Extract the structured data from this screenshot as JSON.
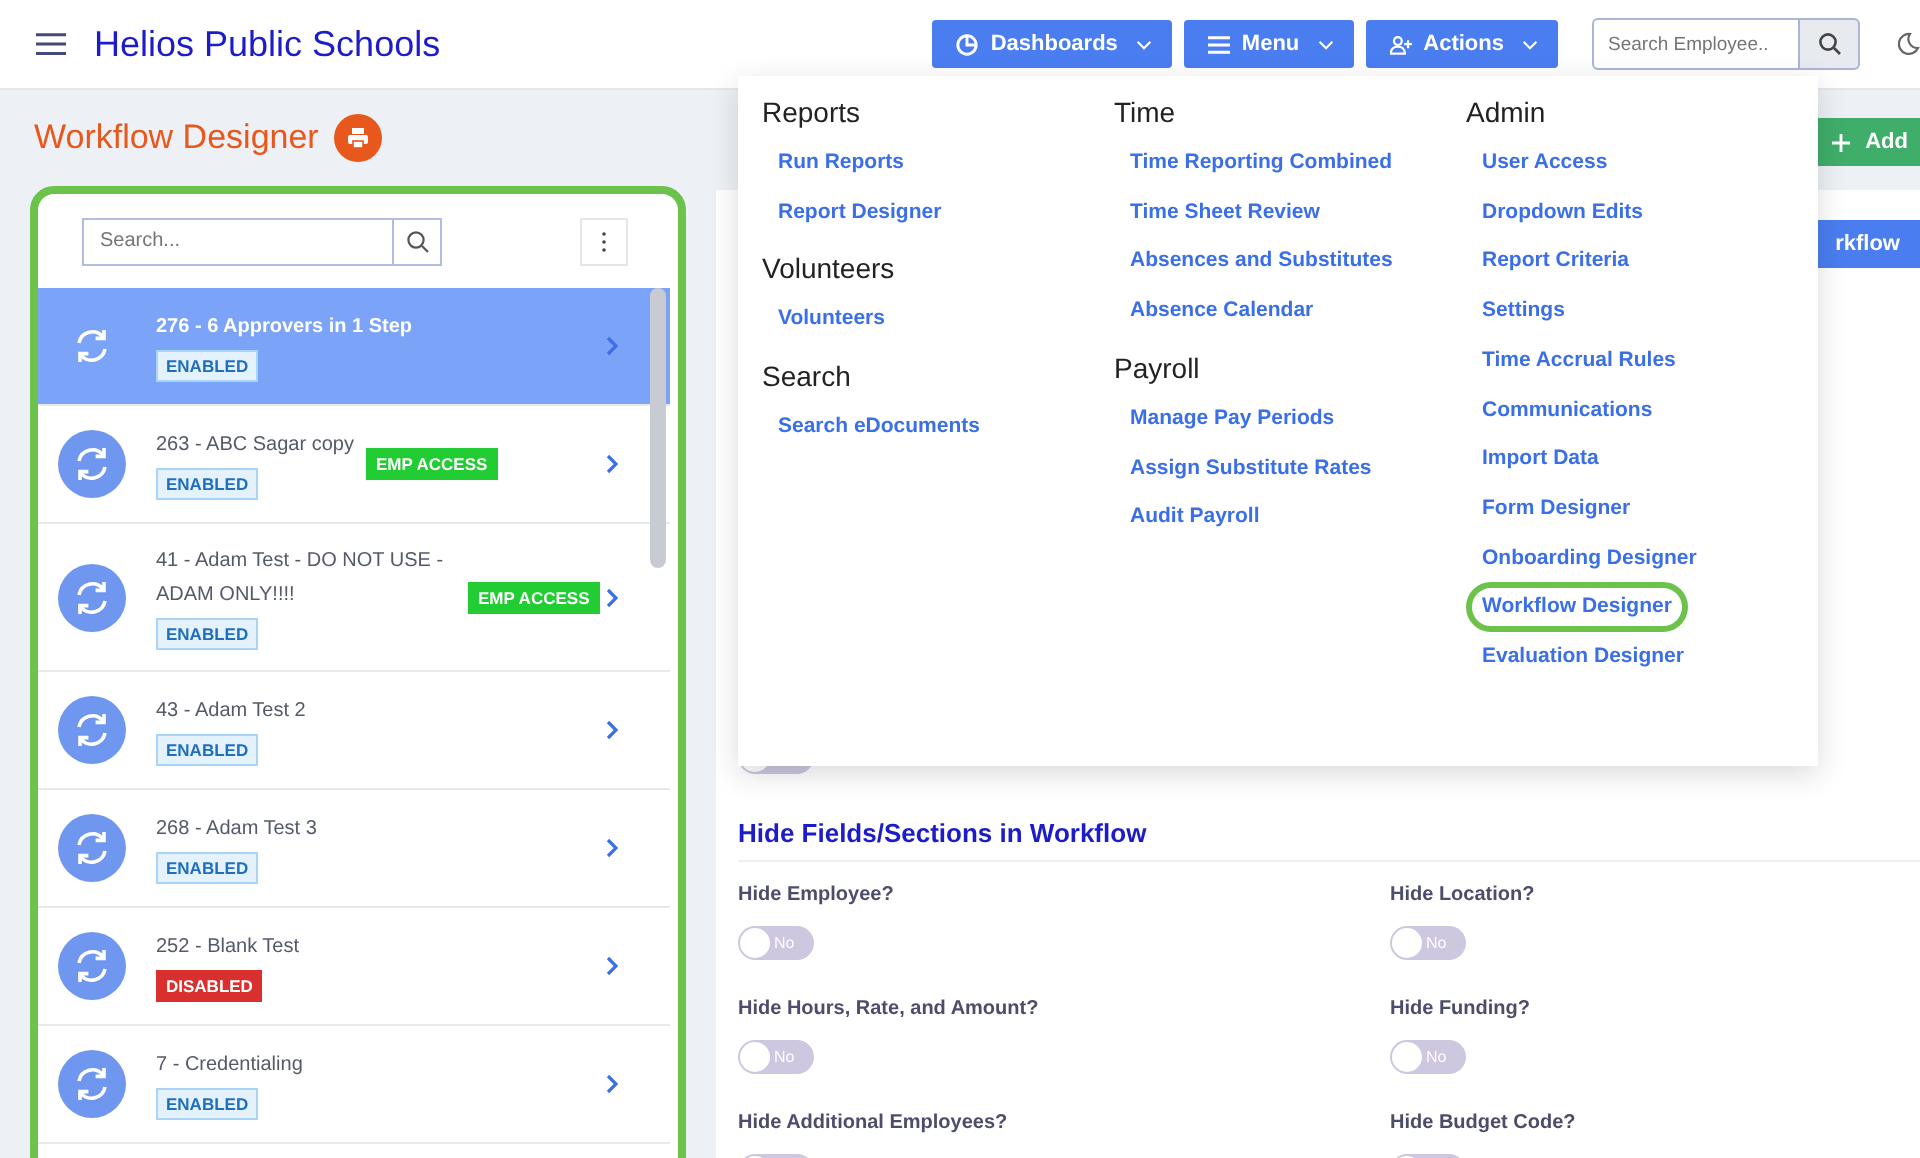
{
  "header": {
    "title": "Helios Public Schools",
    "buttons": [
      {
        "label": "Dashboards",
        "kind": "dashboards"
      },
      {
        "label": "Menu",
        "kind": "menu"
      },
      {
        "label": "Actions",
        "kind": "actions"
      }
    ],
    "search": {
      "placeholder": "Search Employee.."
    }
  },
  "page": {
    "title": "Workflow Designer"
  },
  "list": {
    "search": {
      "placeholder": "Search..."
    },
    "rows": [
      {
        "name": "276 - 6 Approvers in 1 Step",
        "status": {
          "text": "ENABLED",
          "kind": "enabled"
        },
        "selected": true
      },
      {
        "name": "263 - ABC Sagar copy",
        "status": {
          "text": "ENABLED",
          "kind": "enabled"
        },
        "tag": "EMP ACCESS",
        "selected": false
      },
      {
        "name": "41 - Adam Test - DO NOT USE - ADAM ONLY!!!!",
        "status": {
          "text": "ENABLED",
          "kind": "enabled"
        },
        "tag": "EMP ACCESS",
        "selected": false
      },
      {
        "name": "43 - Adam Test 2",
        "status": {
          "text": "ENABLED",
          "kind": "enabled"
        },
        "selected": false
      },
      {
        "name": "268 - Adam Test 3",
        "status": {
          "text": "ENABLED",
          "kind": "enabled"
        },
        "selected": false
      },
      {
        "name": "252 - Blank Test",
        "status": {
          "text": "DISABLED",
          "kind": "disabled"
        },
        "selected": false
      },
      {
        "name": "7 - Credentialing",
        "status": {
          "text": "ENABLED",
          "kind": "enabled"
        },
        "selected": false
      }
    ]
  },
  "content": {
    "add_button": "Add",
    "workflow_button": "rkflow",
    "partial_toggle": {
      "on": false
    },
    "section_title": "Hide Fields/Sections in Workflow",
    "fields": [
      {
        "label": "Hide Employee?",
        "on": false,
        "text": "No"
      },
      {
        "label": "Hide Location?",
        "on": false,
        "text": "No"
      },
      {
        "label": "Hide Hours, Rate, and Amount?",
        "on": false,
        "text": "No"
      },
      {
        "label": "Hide Funding?",
        "on": false,
        "text": "No"
      },
      {
        "label": "Hide Additional Employees?",
        "on": false
      },
      {
        "label": "Hide Budget Code?",
        "on": false
      }
    ]
  },
  "menu": {
    "columns": [
      {
        "sections": [
          {
            "heading": "Reports",
            "items": [
              {
                "label": "Run Reports",
                "highlighted": false
              },
              {
                "label": "Report Designer",
                "highlighted": false
              }
            ]
          },
          {
            "heading": "Volunteers",
            "items": [
              {
                "label": "Volunteers",
                "highlighted": false
              }
            ]
          },
          {
            "heading": "Search",
            "items": [
              {
                "label": "Search eDocuments",
                "highlighted": false
              }
            ]
          }
        ]
      },
      {
        "sections": [
          {
            "heading": "Time",
            "items": [
              {
                "label": "Time Reporting Combined",
                "highlighted": false
              },
              {
                "label": "Time Sheet Review",
                "highlighted": false
              },
              {
                "label": "Absences and Substitutes",
                "highlighted": false
              },
              {
                "label": "Absence Calendar",
                "highlighted": false
              }
            ]
          },
          {
            "heading": "Payroll",
            "items": [
              {
                "label": "Manage Pay Periods",
                "highlighted": false
              },
              {
                "label": "Assign Substitute Rates",
                "highlighted": false
              },
              {
                "label": "Audit Payroll",
                "highlighted": false
              }
            ]
          }
        ]
      },
      {
        "sections": [
          {
            "heading": "Admin",
            "items": [
              {
                "label": "User Access",
                "highlighted": false
              },
              {
                "label": "Dropdown Edits",
                "highlighted": false
              },
              {
                "label": "Report Criteria",
                "highlighted": false
              },
              {
                "label": "Settings",
                "highlighted": false
              },
              {
                "label": "Time Accrual Rules",
                "highlighted": false
              },
              {
                "label": "Communications",
                "highlighted": false
              },
              {
                "label": "Import Data",
                "highlighted": false
              },
              {
                "label": "Form Designer",
                "highlighted": false
              },
              {
                "label": "Onboarding Designer",
                "highlighted": false
              },
              {
                "label": "Workflow Designer",
                "highlighted": true
              },
              {
                "label": "Evaluation Designer",
                "highlighted": false
              }
            ]
          }
        ]
      }
    ]
  }
}
